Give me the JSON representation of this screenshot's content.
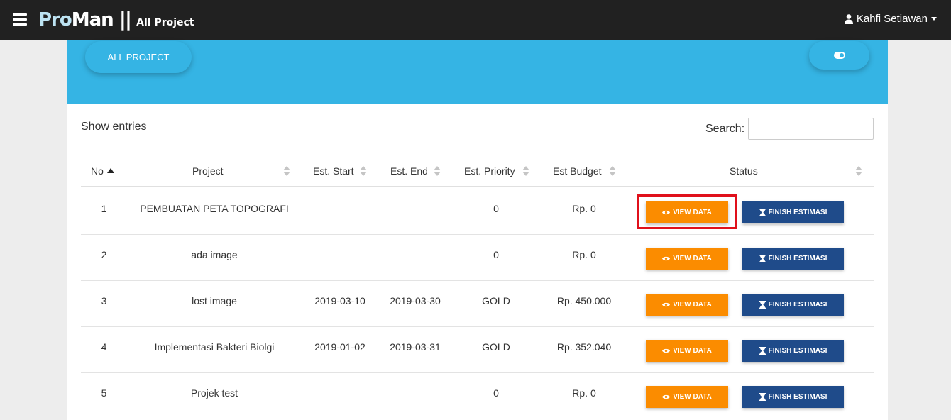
{
  "navbar": {
    "brand_pro": "Pro",
    "brand_man": "Man",
    "brand_separator": "||",
    "brand_subtitle": "All Project",
    "user_name": "Kahfi Setiawan",
    "icons": [
      "menu-icon",
      "user-icon",
      "caret-down-icon"
    ]
  },
  "banner": {
    "all_project_label": "ALL PROJECT",
    "toggle_icon": "toggle-on-icon",
    "color": "#35b4e4"
  },
  "table_controls": {
    "show_entries_label": "Show entries",
    "search_label": "Search:",
    "search_value": ""
  },
  "table": {
    "columns": [
      "No",
      "Project",
      "Est. Start",
      "Est. End",
      "Est. Priority",
      "Est Budget",
      "Status"
    ],
    "sorted_column": "No",
    "sort_direction": "asc",
    "rows": [
      {
        "no": "1",
        "project": "PEMBUATAN PETA TOPOGRAFI",
        "start": "",
        "end": "",
        "priority": "0",
        "budget": "Rp. 0",
        "view_label": "VIEW DATA",
        "finish_label": "FINISH ESTIMASI"
      },
      {
        "no": "2",
        "project": "ada image",
        "start": "",
        "end": "",
        "priority": "0",
        "budget": "Rp. 0",
        "view_label": "VIEW DATA",
        "finish_label": "FINISH ESTIMASI"
      },
      {
        "no": "3",
        "project": "lost image",
        "start": "2019-03-10",
        "end": "2019-03-30",
        "priority": "GOLD",
        "budget": "Rp. 450.000",
        "view_label": "VIEW DATA",
        "finish_label": "FINISH ESTIMASI"
      },
      {
        "no": "4",
        "project": "Implementasi Bakteri Biolgi",
        "start": "2019-01-02",
        "end": "2019-03-31",
        "priority": "GOLD",
        "budget": "Rp. 352.040",
        "view_label": "VIEW DATA",
        "finish_label": "FINISH ESTIMASI"
      },
      {
        "no": "5",
        "project": "Projek test",
        "start": "",
        "end": "",
        "priority": "0",
        "budget": "Rp. 0",
        "view_label": "VIEW DATA",
        "finish_label": "FINISH ESTIMASI"
      }
    ]
  },
  "colors": {
    "navbar": "#212121",
    "view_button": "#fb8c00",
    "finish_button": "#1f4b8a",
    "highlight": "#e0101b"
  }
}
